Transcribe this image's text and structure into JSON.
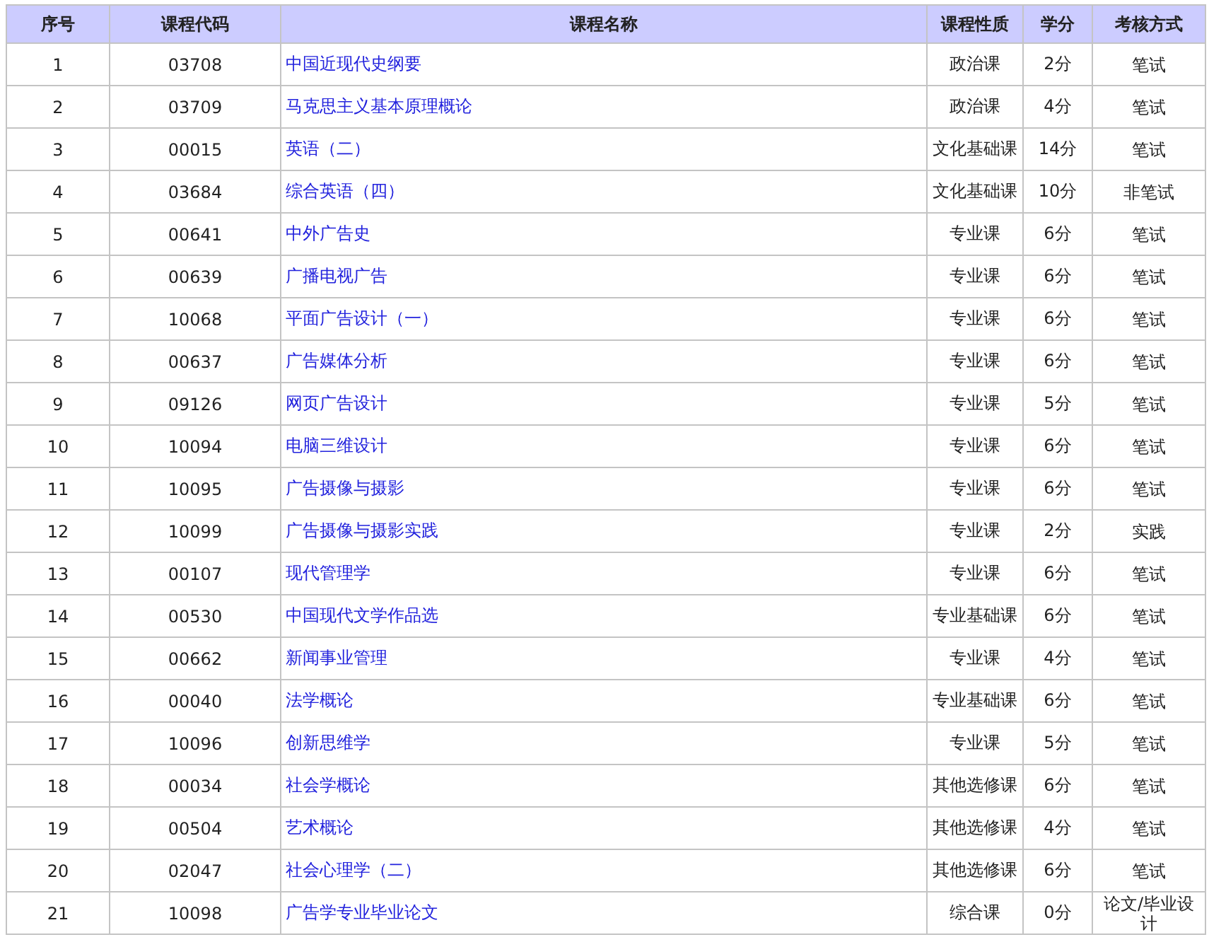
{
  "table": {
    "columns": [
      "序号",
      "课程代码",
      "课程名称",
      "课程性质",
      "学分",
      "考核方式"
    ],
    "rows": [
      {
        "no": "1",
        "code": "03708",
        "name": "中国近现代史纲要",
        "type": "政治课",
        "credits": "2分",
        "exam": "笔试"
      },
      {
        "no": "2",
        "code": "03709",
        "name": "马克思主义基本原理概论",
        "type": "政治课",
        "credits": "4分",
        "exam": "笔试"
      },
      {
        "no": "3",
        "code": "00015",
        "name": "英语（二）",
        "type": "文化基础课",
        "credits": "14分",
        "exam": "笔试"
      },
      {
        "no": "4",
        "code": "03684",
        "name": "综合英语（四）",
        "type": "文化基础课",
        "credits": "10分",
        "exam": "非笔试"
      },
      {
        "no": "5",
        "code": "00641",
        "name": "中外广告史",
        "type": "专业课",
        "credits": "6分",
        "exam": "笔试"
      },
      {
        "no": "6",
        "code": "00639",
        "name": "广播电视广告",
        "type": "专业课",
        "credits": "6分",
        "exam": "笔试"
      },
      {
        "no": "7",
        "code": "10068",
        "name": "平面广告设计（一）",
        "type": "专业课",
        "credits": "6分",
        "exam": "笔试"
      },
      {
        "no": "8",
        "code": "00637",
        "name": "广告媒体分析",
        "type": "专业课",
        "credits": "6分",
        "exam": "笔试"
      },
      {
        "no": "9",
        "code": "09126",
        "name": "网页广告设计",
        "type": "专业课",
        "credits": "5分",
        "exam": "笔试"
      },
      {
        "no": "10",
        "code": "10094",
        "name": "电脑三维设计",
        "type": "专业课",
        "credits": "6分",
        "exam": "笔试"
      },
      {
        "no": "11",
        "code": "10095",
        "name": "广告摄像与摄影",
        "type": "专业课",
        "credits": "6分",
        "exam": "笔试"
      },
      {
        "no": "12",
        "code": "10099",
        "name": "广告摄像与摄影实践",
        "type": "专业课",
        "credits": "2分",
        "exam": "实践"
      },
      {
        "no": "13",
        "code": "00107",
        "name": "现代管理学",
        "type": "专业课",
        "credits": "6分",
        "exam": "笔试"
      },
      {
        "no": "14",
        "code": "00530",
        "name": "中国现代文学作品选",
        "type": "专业基础课",
        "credits": "6分",
        "exam": "笔试"
      },
      {
        "no": "15",
        "code": "00662",
        "name": "新闻事业管理",
        "type": "专业课",
        "credits": "4分",
        "exam": "笔试"
      },
      {
        "no": "16",
        "code": "00040",
        "name": "法学概论",
        "type": "专业基础课",
        "credits": "6分",
        "exam": "笔试"
      },
      {
        "no": "17",
        "code": "10096",
        "name": "创新思维学",
        "type": "专业课",
        "credits": "5分",
        "exam": "笔试"
      },
      {
        "no": "18",
        "code": "00034",
        "name": "社会学概论",
        "type": "其他选修课",
        "credits": "6分",
        "exam": "笔试"
      },
      {
        "no": "19",
        "code": "00504",
        "name": "艺术概论",
        "type": "其他选修课",
        "credits": "4分",
        "exam": "笔试"
      },
      {
        "no": "20",
        "code": "02047",
        "name": "社会心理学（二）",
        "type": "其他选修课",
        "credits": "6分",
        "exam": "笔试"
      },
      {
        "no": "21",
        "code": "10098",
        "name": "广告学专业毕业论文",
        "type": "综合课",
        "credits": "0分",
        "exam": "论文/毕业设计"
      }
    ]
  }
}
